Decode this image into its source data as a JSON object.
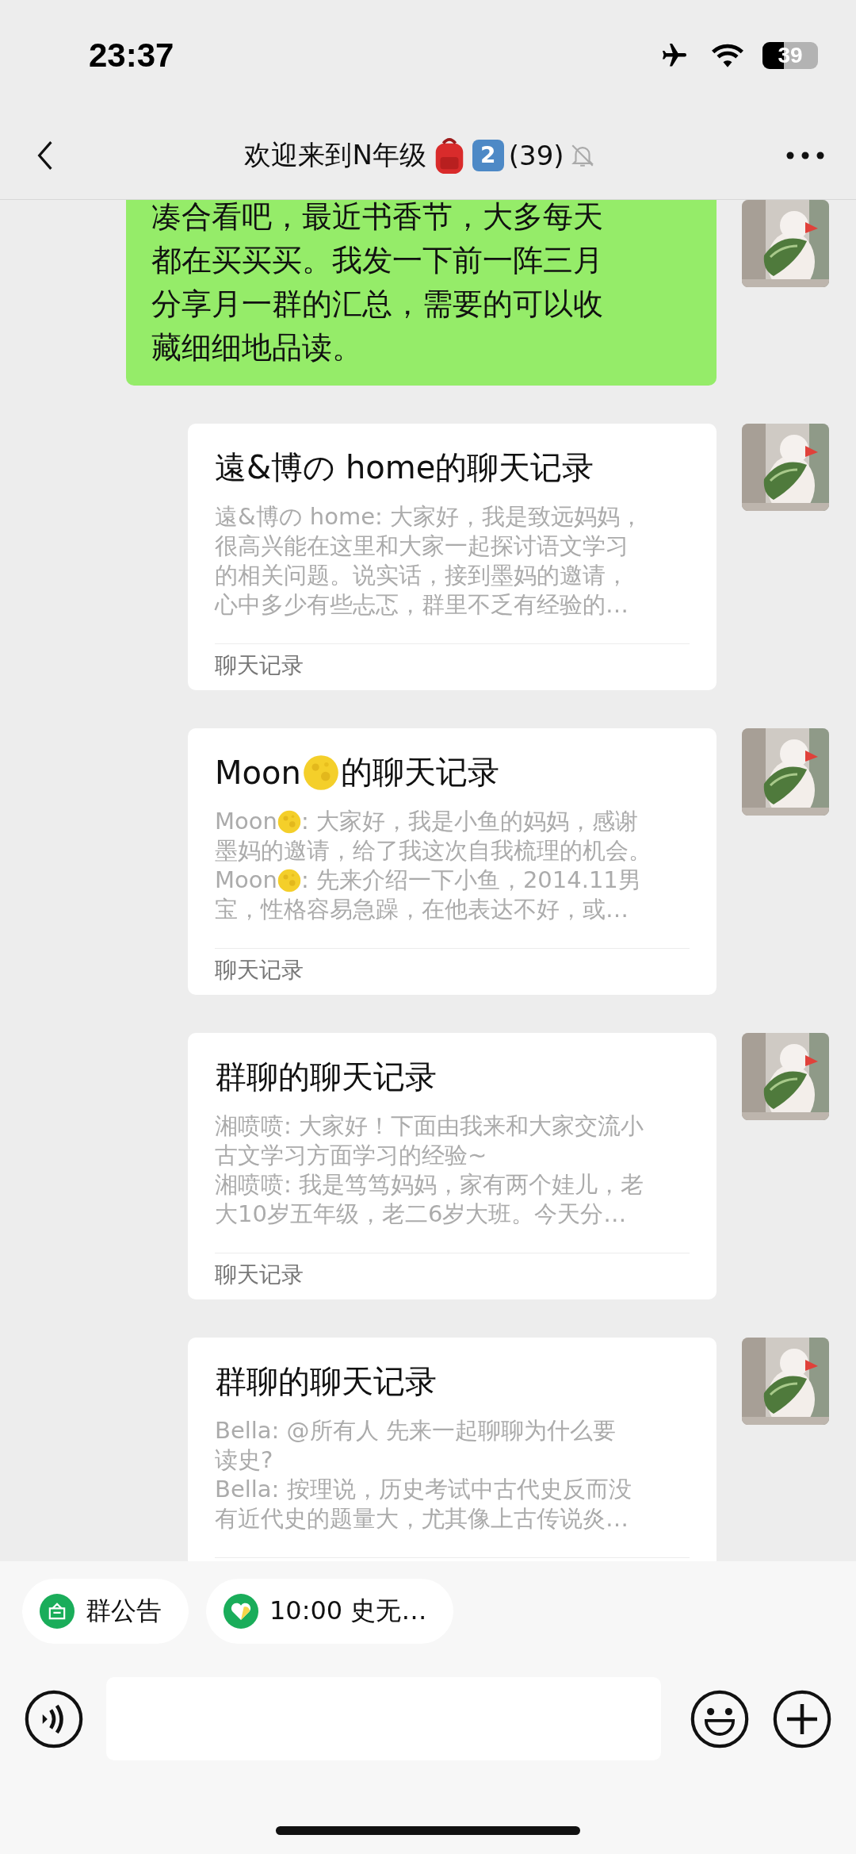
{
  "status_bar": {
    "time": "23:37",
    "battery": "39"
  },
  "nav": {
    "title": [
      {
        "kind": "text",
        "text": "欢迎来到N年级"
      },
      {
        "kind": "backpack"
      },
      {
        "kind": "keycap",
        "text": "2"
      },
      {
        "kind": "text",
        "text": "(39)"
      }
    ],
    "muted": true
  },
  "messages": [
    {
      "kind": "text",
      "lines": [
        "凑合看吧，最近书香节，大多每天",
        "都在买买买。我发一下前一阵三月",
        "分享月一群的汇总，需要的可以收",
        "藏细细地品读。"
      ]
    },
    {
      "kind": "chat_record",
      "title": [
        {
          "kind": "text",
          "text": "遠&博の home的聊天记录"
        }
      ],
      "preview": [
        [
          {
            "kind": "text",
            "text": "遠&博の home: 大家好，我是致远妈妈，"
          }
        ],
        [
          {
            "kind": "text",
            "text": "很高兴能在这里和大家一起探讨语文学习"
          }
        ],
        [
          {
            "kind": "text",
            "text": "的相关问题。说实话，接到墨妈的邀请，"
          }
        ],
        [
          {
            "kind": "text",
            "text": "心中多少有些忐忑，群里不乏有经验的…"
          }
        ]
      ],
      "footer": "聊天记录"
    },
    {
      "kind": "chat_record",
      "title": [
        {
          "kind": "text",
          "text": "Moon"
        },
        {
          "kind": "moon"
        },
        {
          "kind": "text",
          "text": "的聊天记录"
        }
      ],
      "preview": [
        [
          {
            "kind": "text",
            "text": "Moon"
          },
          {
            "kind": "moon"
          },
          {
            "kind": "text",
            "text": ": 大家好，我是小鱼的妈妈，感谢"
          }
        ],
        [
          {
            "kind": "text",
            "text": "墨妈的邀请，给了我这次自我梳理的机会。"
          }
        ],
        [
          {
            "kind": "text",
            "text": "Moon"
          },
          {
            "kind": "moon"
          },
          {
            "kind": "text",
            "text": ": 先来介绍一下小鱼，2014.11男"
          }
        ],
        [
          {
            "kind": "text",
            "text": "宝，性格容易急躁，在他表达不好，或…"
          }
        ]
      ],
      "footer": "聊天记录"
    },
    {
      "kind": "chat_record",
      "title": [
        {
          "kind": "text",
          "text": "群聊的聊天记录"
        }
      ],
      "preview": [
        [
          {
            "kind": "text",
            "text": "湘喷喷: 大家好！下面由我来和大家交流小"
          }
        ],
        [
          {
            "kind": "text",
            "text": "古文学习方面学习的经验~"
          }
        ],
        [
          {
            "kind": "text",
            "text": "湘喷喷: 我是笃笃妈妈，家有两个娃儿，老"
          }
        ],
        [
          {
            "kind": "text",
            "text": "大10岁五年级，老二6岁大班。今天分…"
          }
        ]
      ],
      "footer": "聊天记录"
    },
    {
      "kind": "chat_record",
      "title": [
        {
          "kind": "text",
          "text": "群聊的聊天记录"
        }
      ],
      "preview": [
        [
          {
            "kind": "text",
            "text": "Bella: @所有人 先来一起聊聊为什么要"
          }
        ],
        [
          {
            "kind": "text",
            "text": "读史?"
          }
        ],
        [
          {
            "kind": "text",
            "text": "Bella: 按理说，历史考试中古代史反而没"
          }
        ],
        [
          {
            "kind": "text",
            "text": "有近代史的题量大，尤其像上古传说炎…"
          }
        ]
      ]
    }
  ],
  "chips": [
    {
      "kind": "notice",
      "label": "群公告"
    },
    {
      "kind": "event",
      "label": "10:00 史无…"
    }
  ]
}
